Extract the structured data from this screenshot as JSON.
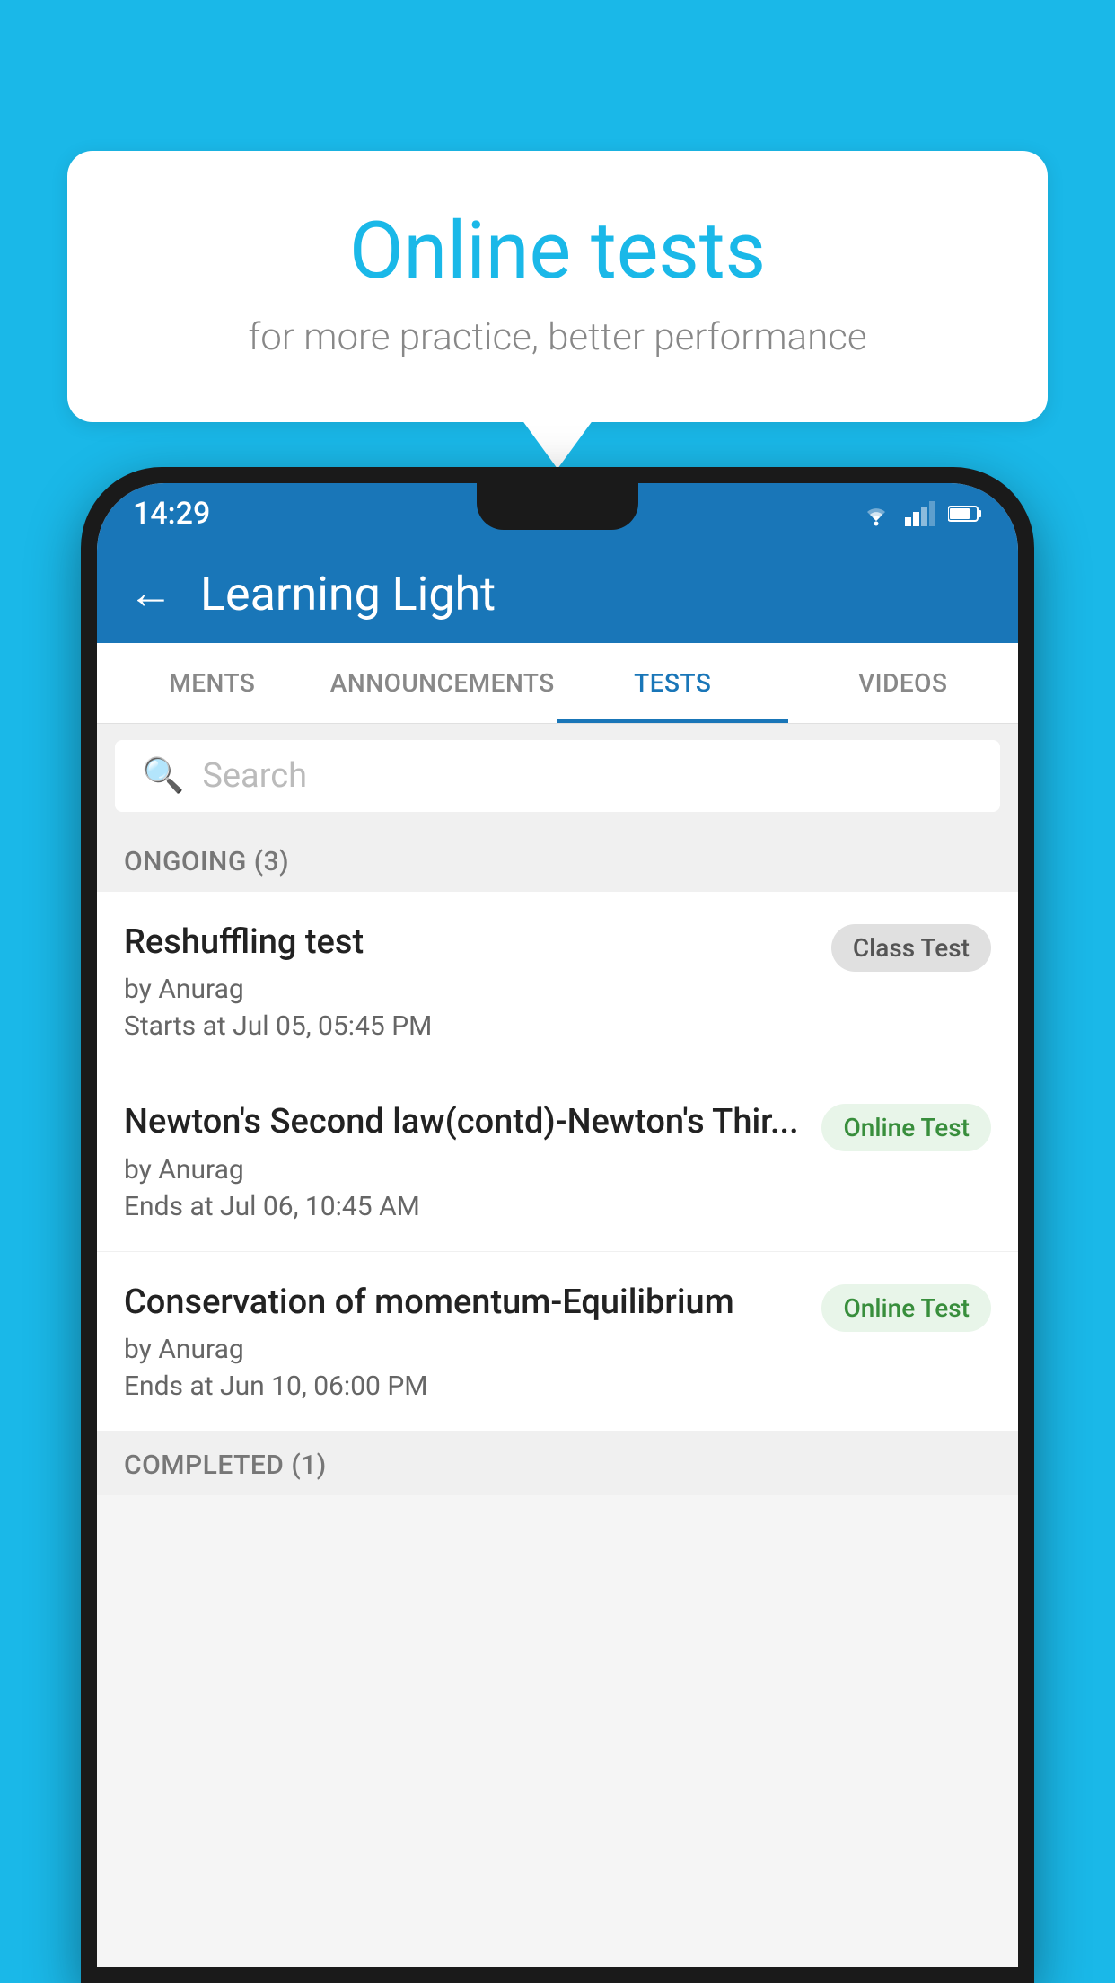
{
  "background": {
    "color": "#1ab8e8"
  },
  "speech_bubble": {
    "title": "Online tests",
    "subtitle": "for more practice, better performance"
  },
  "status_bar": {
    "time": "14:29",
    "icons": [
      "wifi",
      "signal",
      "battery"
    ]
  },
  "app_bar": {
    "back_label": "←",
    "title": "Learning Light"
  },
  "tabs": [
    {
      "label": "MENTS",
      "active": false
    },
    {
      "label": "ANNOUNCEMENTS",
      "active": false
    },
    {
      "label": "TESTS",
      "active": true
    },
    {
      "label": "VIDEOS",
      "active": false
    }
  ],
  "search": {
    "placeholder": "Search",
    "icon": "🔍"
  },
  "ongoing_section": {
    "label": "ONGOING (3)"
  },
  "test_items": [
    {
      "name": "Reshuffling test",
      "author": "by Anurag",
      "date": "Starts at  Jul 05, 05:45 PM",
      "badge": "Class Test",
      "badge_type": "class"
    },
    {
      "name": "Newton's Second law(contd)-Newton's Thir...",
      "author": "by Anurag",
      "date": "Ends at  Jul 06, 10:45 AM",
      "badge": "Online Test",
      "badge_type": "online"
    },
    {
      "name": "Conservation of momentum-Equilibrium",
      "author": "by Anurag",
      "date": "Ends at  Jun 10, 06:00 PM",
      "badge": "Online Test",
      "badge_type": "online"
    }
  ],
  "completed_section": {
    "label": "COMPLETED (1)"
  }
}
